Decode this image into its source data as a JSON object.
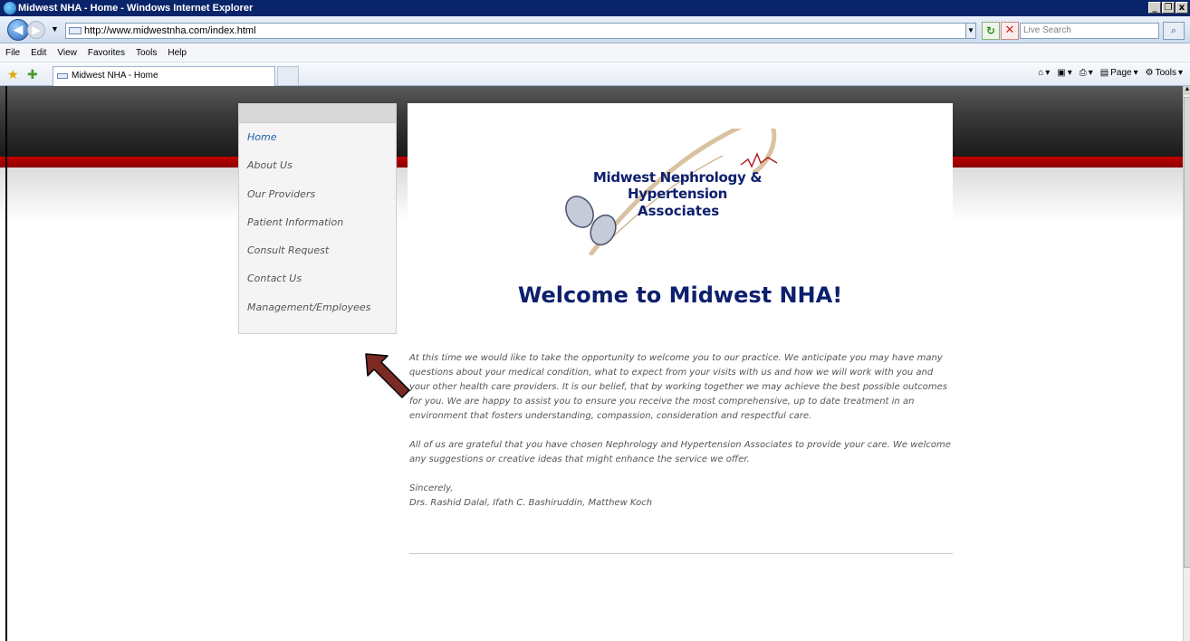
{
  "window": {
    "title": "Midwest NHA - Home - Windows Internet Explorer",
    "buttons": [
      "_",
      "❐",
      "x"
    ]
  },
  "browser": {
    "address": "http://www.midwestnha.com/index.html",
    "search_placeholder": "Live Search",
    "menu": [
      "File",
      "Edit",
      "View",
      "Favorites",
      "Tools",
      "Help"
    ],
    "tab_title": "Midwest NHA - Home",
    "commands": {
      "page": "Page",
      "tools": "Tools"
    }
  },
  "site": {
    "logo": {
      "line1": "Midwest Nephrology & Hypertension",
      "line2": "Associates"
    },
    "nav": [
      {
        "label": "Home",
        "active": true
      },
      {
        "label": "About Us",
        "active": false
      },
      {
        "label": "Our Providers",
        "active": false
      },
      {
        "label": "Patient Information",
        "active": false
      },
      {
        "label": "Consult Request",
        "active": false
      },
      {
        "label": "Contact Us",
        "active": false
      },
      {
        "label": "Management/Employees",
        "active": false
      }
    ],
    "welcome": "Welcome to Midwest NHA!",
    "paragraph1": "At this time we would like to take the opportunity to welcome you to our practice. We anticipate you may have many questions about your medical condition, what to expect from your visits with us and how we will work with you and your other health care providers. It is our belief, that by working together we may achieve the best possible outcomes for you. We are happy to assist you to ensure you receive the most comprehensive, up to date treatment in an environment that fosters understanding, compassion, consideration and respectful care.",
    "paragraph2": "All of us are grateful that you have chosen Nephrology and Hypertension Associates to provide your care. We welcome any suggestions or creative ideas that might enhance the service we offer.",
    "closing": "Sincerely,",
    "signature": "Drs. Rashid Dalal, Ifath C. Bashiruddin, Matthew Koch"
  },
  "colors": {
    "title_navy": "#0d1f6e",
    "nav_active": "#1f5fa8",
    "header_red": "#a00000",
    "annotation_arrow": "#7a2a22"
  }
}
